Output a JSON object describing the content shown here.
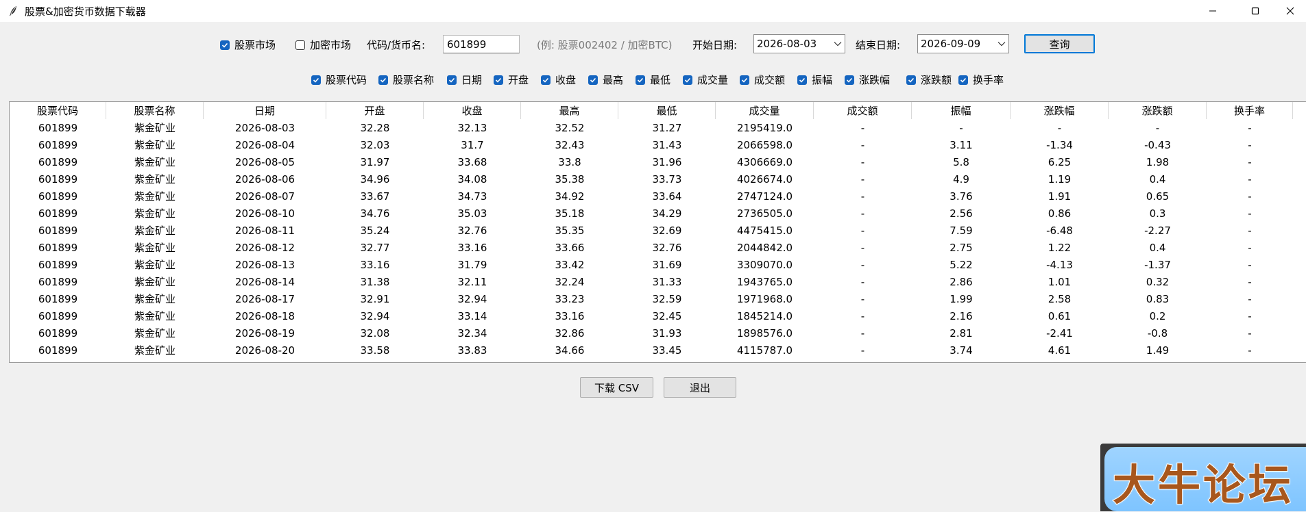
{
  "window": {
    "title": "股票&加密货币数据下载器",
    "controls": [
      "minimize-icon",
      "maximize-icon",
      "close-icon"
    ]
  },
  "market": {
    "stock_label": "股票市场",
    "stock_checked": true,
    "crypto_label": "加密市场",
    "crypto_checked": false
  },
  "code": {
    "label": "代码/货币名:",
    "value": "601899",
    "hint": "(例: 股票002402 / 加密BTC)"
  },
  "start_date": {
    "label": "开始日期:",
    "value": "2026-08-03"
  },
  "end_date": {
    "label": "结束日期:",
    "value": "2026-09-09"
  },
  "query_label": "查询",
  "columns_filter": [
    {
      "label": "股票代码",
      "checked": true
    },
    {
      "label": "股票名称",
      "checked": true
    },
    {
      "label": "日期",
      "checked": true
    },
    {
      "label": "开盘",
      "checked": true
    },
    {
      "label": "收盘",
      "checked": true
    },
    {
      "label": "最高",
      "checked": true
    },
    {
      "label": "最低",
      "checked": true
    },
    {
      "label": "成交量",
      "checked": true
    },
    {
      "label": "成交额",
      "checked": true
    },
    {
      "label": "振幅",
      "checked": true
    },
    {
      "label": "涨跌幅",
      "checked": true
    },
    {
      "label": "涨跌额",
      "checked": true
    },
    {
      "label": "换手率",
      "checked": true
    }
  ],
  "table": {
    "headers": [
      "股票代码",
      "股票名称",
      "日期",
      "开盘",
      "收盘",
      "最高",
      "最低",
      "成交量",
      "成交额",
      "振幅",
      "涨跌幅",
      "涨跌额",
      "换手率"
    ],
    "rows": [
      [
        "601899",
        "紫金矿业",
        "2026-08-03",
        "32.28",
        "32.13",
        "32.52",
        "31.27",
        "2195419.0",
        "-",
        "-",
        "-",
        "-",
        "-"
      ],
      [
        "601899",
        "紫金矿业",
        "2026-08-04",
        "32.03",
        "31.7",
        "32.43",
        "31.43",
        "2066598.0",
        "-",
        "3.11",
        "-1.34",
        "-0.43",
        "-"
      ],
      [
        "601899",
        "紫金矿业",
        "2026-08-05",
        "31.97",
        "33.68",
        "33.8",
        "31.96",
        "4306669.0",
        "-",
        "5.8",
        "6.25",
        "1.98",
        "-"
      ],
      [
        "601899",
        "紫金矿业",
        "2026-08-06",
        "34.96",
        "34.08",
        "35.38",
        "33.73",
        "4026674.0",
        "-",
        "4.9",
        "1.19",
        "0.4",
        "-"
      ],
      [
        "601899",
        "紫金矿业",
        "2026-08-07",
        "33.67",
        "34.73",
        "34.92",
        "33.64",
        "2747124.0",
        "-",
        "3.76",
        "1.91",
        "0.65",
        "-"
      ],
      [
        "601899",
        "紫金矿业",
        "2026-08-10",
        "34.76",
        "35.03",
        "35.18",
        "34.29",
        "2736505.0",
        "-",
        "2.56",
        "0.86",
        "0.3",
        "-"
      ],
      [
        "601899",
        "紫金矿业",
        "2026-08-11",
        "35.24",
        "32.76",
        "35.35",
        "32.69",
        "4475415.0",
        "-",
        "7.59",
        "-6.48",
        "-2.27",
        "-"
      ],
      [
        "601899",
        "紫金矿业",
        "2026-08-12",
        "32.77",
        "33.16",
        "33.66",
        "32.76",
        "2044842.0",
        "-",
        "2.75",
        "1.22",
        "0.4",
        "-"
      ],
      [
        "601899",
        "紫金矿业",
        "2026-08-13",
        "33.16",
        "31.79",
        "33.42",
        "31.69",
        "3309070.0",
        "-",
        "5.22",
        "-4.13",
        "-1.37",
        "-"
      ],
      [
        "601899",
        "紫金矿业",
        "2026-08-14",
        "31.38",
        "32.11",
        "32.24",
        "31.33",
        "1943765.0",
        "-",
        "2.86",
        "1.01",
        "0.32",
        "-"
      ],
      [
        "601899",
        "紫金矿业",
        "2026-08-17",
        "32.91",
        "32.94",
        "33.23",
        "32.59",
        "1971968.0",
        "-",
        "1.99",
        "2.58",
        "0.83",
        "-"
      ],
      [
        "601899",
        "紫金矿业",
        "2026-08-18",
        "32.94",
        "33.14",
        "33.16",
        "32.45",
        "1845214.0",
        "-",
        "2.16",
        "0.61",
        "0.2",
        "-"
      ],
      [
        "601899",
        "紫金矿业",
        "2026-08-19",
        "32.08",
        "32.34",
        "32.86",
        "31.93",
        "1898576.0",
        "-",
        "2.81",
        "-2.41",
        "-0.8",
        "-"
      ],
      [
        "601899",
        "紫金矿业",
        "2026-08-20",
        "33.58",
        "33.83",
        "34.66",
        "33.45",
        "4115787.0",
        "-",
        "3.74",
        "4.61",
        "1.49",
        "-"
      ]
    ]
  },
  "download_label": "下载 CSV",
  "exit_label": "退出",
  "watermark": {
    "text": "大牛论坛"
  },
  "colors": {
    "accent": "#1565c0",
    "background": "#f0f0f0",
    "watermark_bg": "#8ccbff",
    "watermark_text": "#a8571d"
  }
}
